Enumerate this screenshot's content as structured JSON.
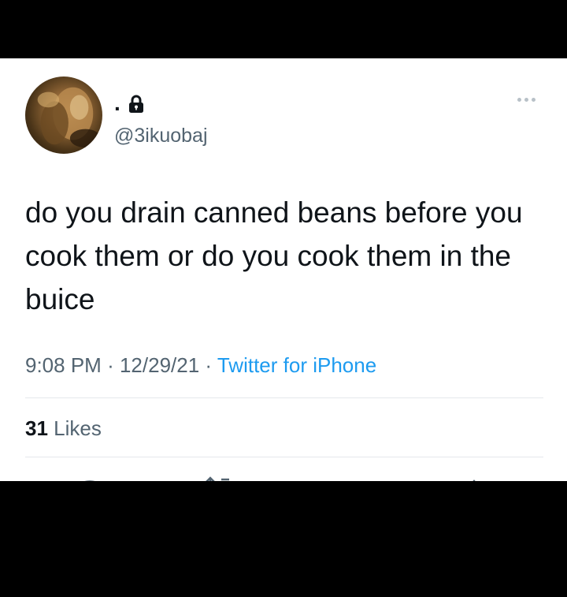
{
  "tweet": {
    "display_name": ".",
    "handle": "@3ikuobaj",
    "text": "do you drain canned beans before you cook them or do you cook them in the buice",
    "time": "9:08 PM",
    "separator": "·",
    "date": "12/29/21",
    "source": "Twitter for iPhone",
    "likes_count": "31",
    "likes_label": "Likes"
  },
  "icons": {
    "protected": "lock-icon",
    "more": "more-icon",
    "actions": [
      "reply-icon",
      "retweet-icon",
      "like-icon",
      "share-icon"
    ]
  },
  "colors": {
    "text_primary": "#0f1419",
    "text_secondary": "#536471",
    "link": "#1d9bf0",
    "divider": "#e5e8eb",
    "background": "#ffffff",
    "letterbox": "#000000"
  }
}
